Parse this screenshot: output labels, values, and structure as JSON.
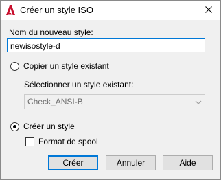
{
  "window": {
    "title": "Créer un style ISO",
    "app_icon": "autocad-a-icon",
    "close_icon": "close-icon"
  },
  "form": {
    "name_label": "Nom du nouveau style:",
    "name_value": "newisostyle-d",
    "copy_option_label": "Copier un style existant",
    "copy_option_checked": false,
    "select_existing_label": "Sélectionner un style existant:",
    "select_existing_value": "Check_ANSI-B",
    "select_existing_disabled": true,
    "create_option_label": "Créer un style",
    "create_option_checked": true,
    "spool_format_label": "Format de spool",
    "spool_format_checked": false
  },
  "buttons": {
    "create_label": "Créer",
    "cancel_label": "Annuler",
    "help_label": "Aide"
  },
  "colors": {
    "accent": "#0078d7",
    "app_icon_red": "#c8102e"
  }
}
